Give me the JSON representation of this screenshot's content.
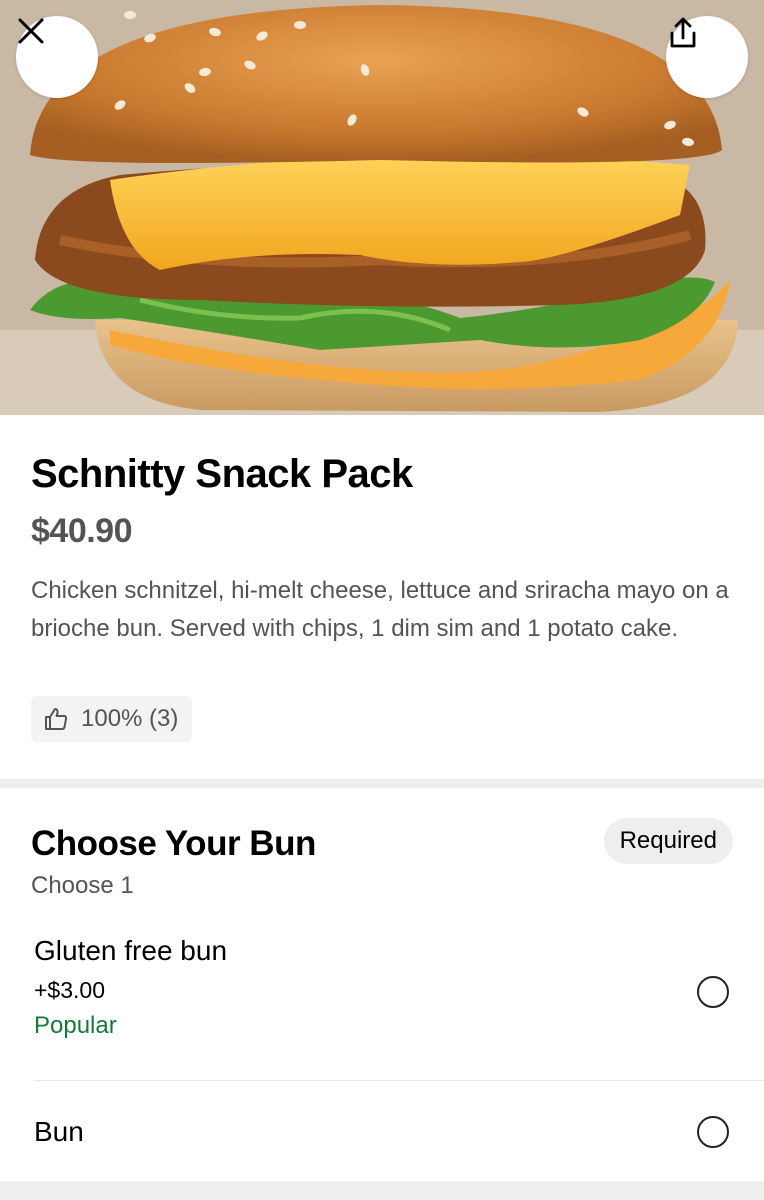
{
  "header": {
    "close_icon": "close-icon",
    "share_icon": "share-icon"
  },
  "item": {
    "title": "Schnitty Snack Pack",
    "price": "$40.90",
    "description": "Chicken schnitzel, hi-melt cheese, lettuce and sriracha mayo on a brioche bun. Served with chips, 1 dim sim and 1 potato cake.",
    "rating": {
      "icon": "thumbs-up-icon",
      "text": "100% (3)"
    }
  },
  "options_section": {
    "title": "Choose Your Bun",
    "subtitle": "Choose 1",
    "badge": "Required",
    "options": [
      {
        "name": "Gluten free bun",
        "price": "+$3.00",
        "tag": "Popular",
        "selected": false
      },
      {
        "name": "Bun",
        "selected": false
      }
    ]
  },
  "colors": {
    "popular_tag": "#137a3b",
    "secondary_text": "#545454",
    "chip_background": "#eeeeee"
  }
}
